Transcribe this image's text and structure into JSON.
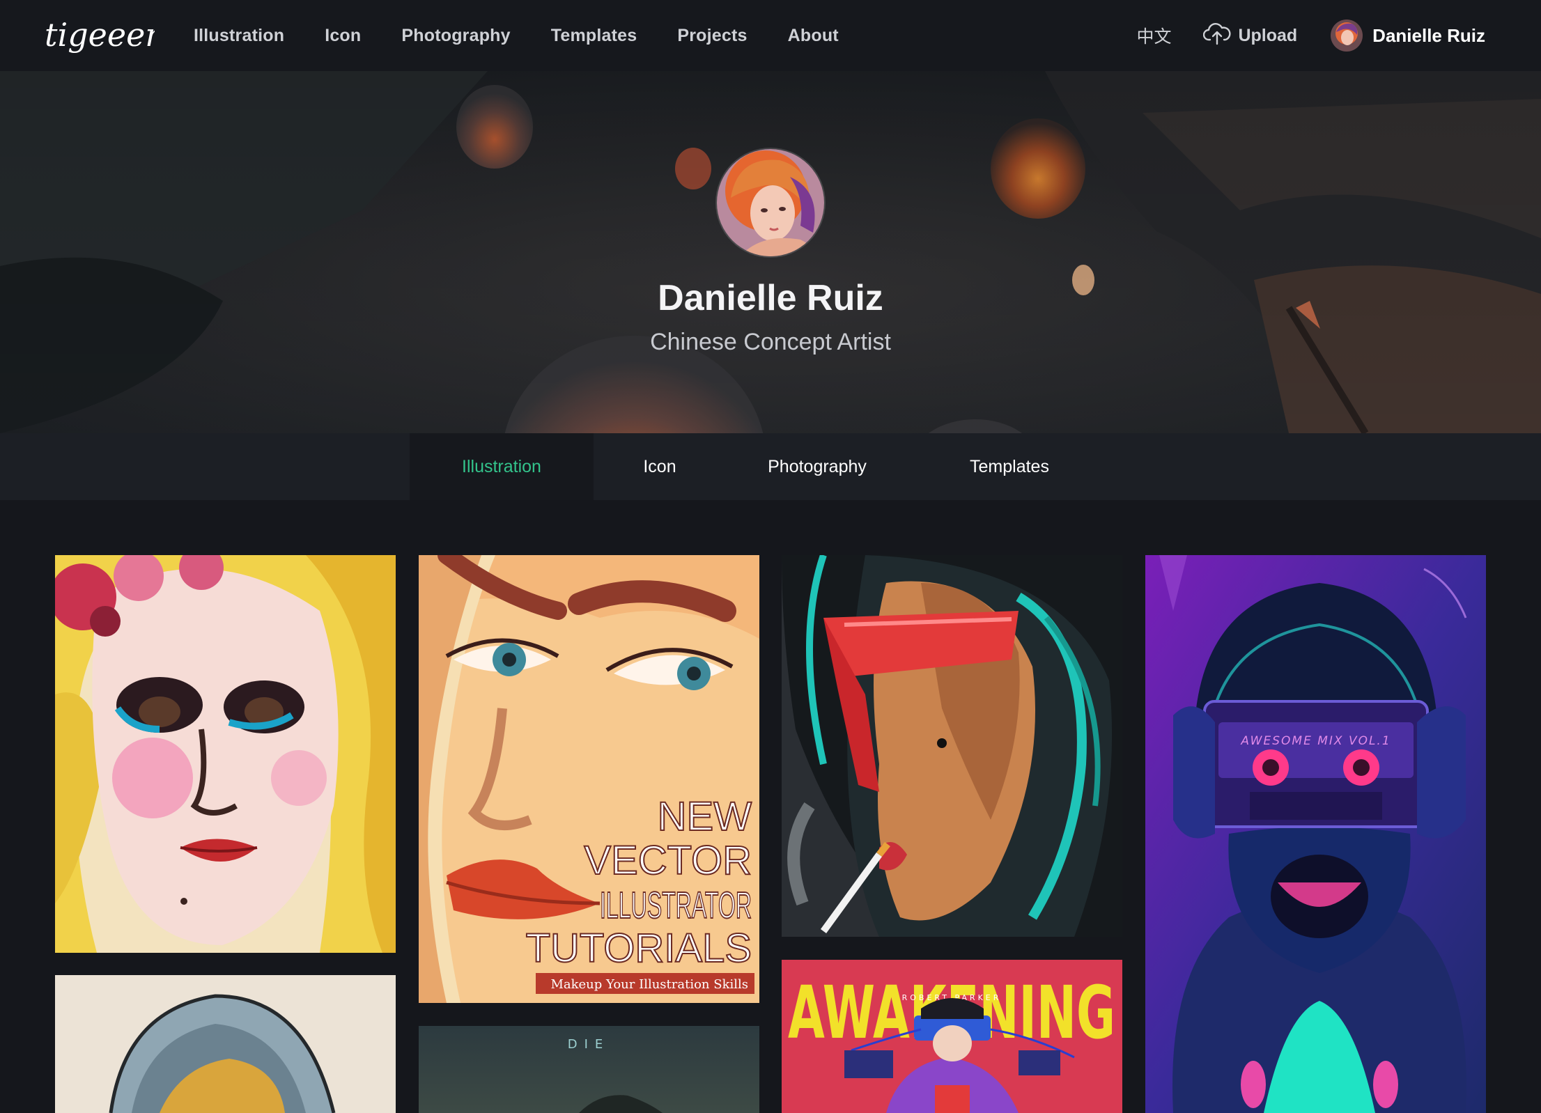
{
  "brand": {
    "logo_text": "tigeeer"
  },
  "nav": {
    "links": [
      "Illustration",
      "Icon",
      "Photography",
      "Templates",
      "Projects",
      "About"
    ],
    "language": "中文",
    "upload_label": "Upload",
    "user_name": "Danielle Ruiz"
  },
  "profile": {
    "name": "Danielle Ruiz",
    "title": "Chinese Concept Artist"
  },
  "tabs": {
    "items": [
      "Illustration",
      "Icon",
      "Photography",
      "Templates"
    ],
    "active": "Illustration"
  },
  "gallery": {
    "card2_headline": [
      "NEW",
      "VECTOR",
      "ILLUSTRATOR",
      "TUTORIALS"
    ],
    "card2_caption": "Makeup Your Illustration Skills",
    "card4_cassette_text": "AWESOME MIX VOL.1",
    "card5_title": "AWAKENING",
    "card5_subtitle": "ROBERT PARKER",
    "card6_label": "DIE"
  },
  "colors": {
    "accent": "#33c38b",
    "nav_bg": "#16181d",
    "page_bg": "#15171c",
    "tabbar_bg": "#1c1f25"
  }
}
